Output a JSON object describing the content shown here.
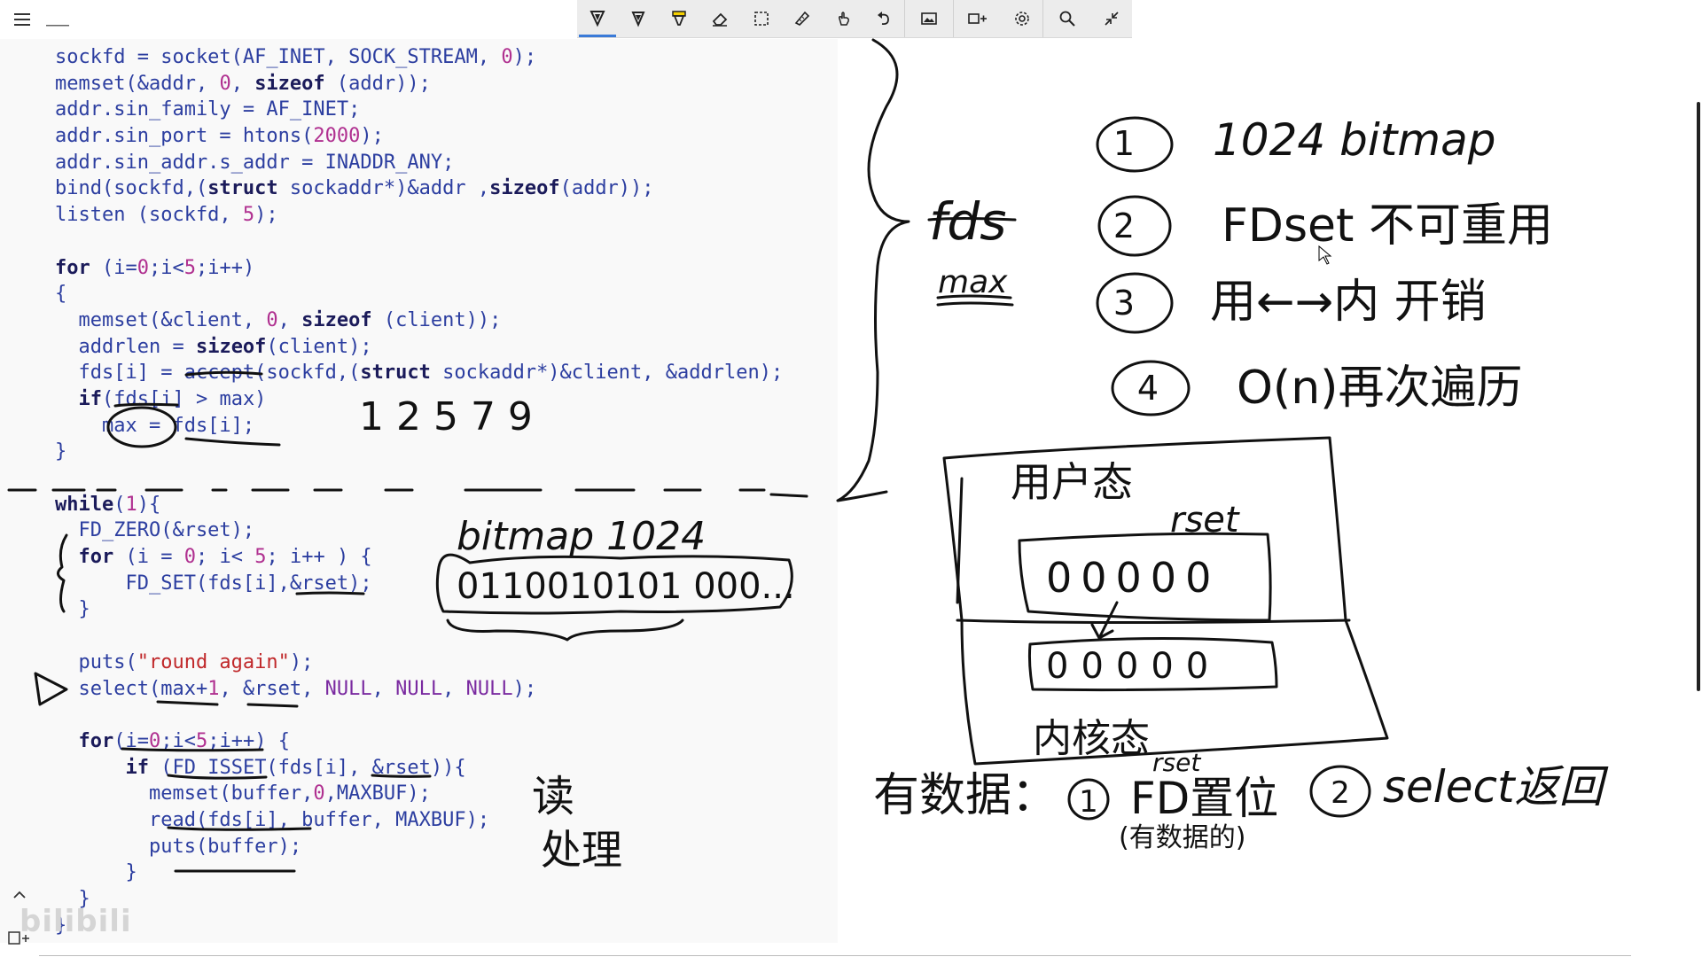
{
  "app": {
    "watermark": "bilibili"
  },
  "toolbar": {
    "tools": [
      {
        "name": "pen",
        "icon": "pen-icon",
        "active": true
      },
      {
        "name": "pen-alt",
        "icon": "pen-icon"
      },
      {
        "name": "highlighter",
        "icon": "highlighter-icon"
      },
      {
        "name": "eraser",
        "icon": "eraser-icon"
      },
      {
        "name": "lasso-select",
        "icon": "lasso-select-icon"
      },
      {
        "name": "ruler",
        "icon": "ruler-icon"
      },
      {
        "name": "touch-writing",
        "icon": "touch-writing-icon"
      },
      {
        "name": "undo",
        "icon": "undo-icon"
      },
      {
        "name": "insert-image",
        "icon": "image-icon"
      },
      {
        "name": "add-space",
        "icon": "add-space-icon"
      },
      {
        "name": "settings",
        "icon": "gear-icon"
      },
      {
        "name": "zoom",
        "icon": "magnifier-icon"
      },
      {
        "name": "collapse",
        "icon": "collapse-icon"
      }
    ]
  },
  "code": {
    "lines": [
      "sockfd = socket(AF_INET, SOCK_STREAM, 0);",
      "memset(&addr, 0, sizeof (addr));",
      "addr.sin_family = AF_INET;",
      "addr.sin_port = htons(2000);",
      "addr.sin_addr.s_addr = INADDR_ANY;",
      "bind(sockfd,(struct sockaddr*)&addr ,sizeof(addr));",
      "listen (sockfd, 5);",
      "",
      "for (i=0;i<5;i++)",
      "{",
      "  memset(&client, 0, sizeof (client));",
      "  addrlen = sizeof(client);",
      "  fds[i] = accept(sockfd,(struct sockaddr*)&client, &addrlen);",
      "  if(fds[i] > max)",
      "    max = fds[i];",
      "}",
      "",
      "while(1){",
      "  FD_ZERO(&rset);",
      "  for (i = 0; i< 5; i++ ) {",
      "      FD_SET(fds[i],&rset);",
      "  }",
      "",
      "  puts(\"round again\");",
      "  select(max+1, &rset, NULL, NULL, NULL);",
      "",
      "  for(i=0;i<5;i++) {",
      "      if (FD_ISSET(fds[i], &rset)){",
      "        memset(buffer,0,MAXBUF);",
      "        read(fds[i], buffer, MAXBUF);",
      "        puts(buffer);",
      "      }",
      "  }",
      "}"
    ]
  },
  "notes": {
    "fds_numbers": "1 2 5 7 9",
    "bitmap_label": "bitmap 1024",
    "bitmap_bits": "0110010101 000...",
    "read_label": "读",
    "process_label": "处理",
    "fds_label": "fds",
    "max_label": "max",
    "list": [
      {
        "num": "1",
        "text": "1024 bitmap"
      },
      {
        "num": "2",
        "text": "FDset 不可重用"
      },
      {
        "num": "3",
        "text": "用←→内 开销"
      },
      {
        "num": "4",
        "text": "O(n)再次遍历"
      }
    ],
    "user_mode": "用户态",
    "rset_label": "rset",
    "user_bits": "00000",
    "kernel_bits": "00000",
    "kernel_mode": "内核态",
    "has_data": "有数据：",
    "step1": "FD置位",
    "step1_sub": "(有数据的)",
    "step1_rset": "rset",
    "step2": "select返回"
  },
  "colors": {
    "code_text": "#2c3ea0",
    "keyword": "#1b1b5a",
    "number": "#b03090",
    "string": "#c0282a",
    "ink": "#111111",
    "toolbar_bg": "#ececec",
    "active_accent": "#3a7ad8"
  }
}
